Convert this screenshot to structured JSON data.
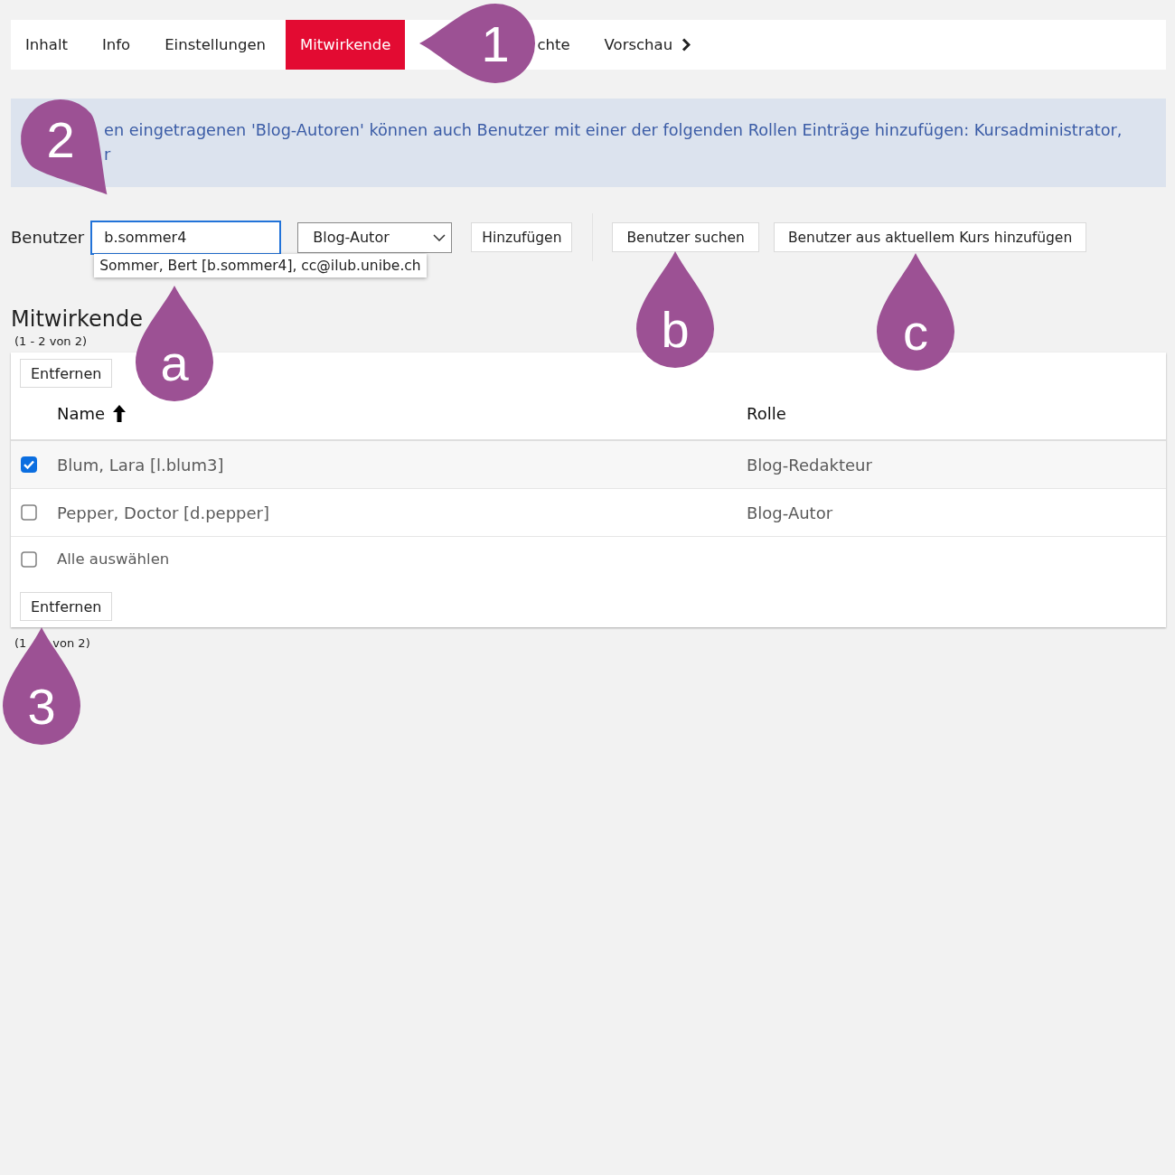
{
  "tabs": [
    {
      "label": "Inhalt",
      "selected": false,
      "expandable": false
    },
    {
      "label": "Info",
      "selected": false,
      "expandable": false
    },
    {
      "label": "Einstellungen",
      "selected": false,
      "expandable": false
    },
    {
      "label": "Mitwirkende",
      "selected": true,
      "expandable": false
    },
    {
      "label": "chte",
      "selected": false,
      "expandable": false
    },
    {
      "label": "Vorschau",
      "selected": false,
      "expandable": true
    }
  ],
  "info": {
    "lines": [
      "en eingetragenen 'Blog-Autoren' können auch Benutzer mit einer der folgenden Rollen Einträge hinzufügen: Kursadministrator,",
      "r"
    ]
  },
  "user_form": {
    "label": "Benutzer",
    "input": {
      "value": "b.sommer4",
      "focused": true
    },
    "suggestion": "Sommer, Bert [b.sommer4], cc@ilub.unibe.ch",
    "role_select": {
      "value": "Blog-Autor"
    },
    "add_button": "Hinzufügen",
    "search_button": "Benutzer suchen",
    "course_button": "Benutzer aus aktuellem Kurs hinzufügen"
  },
  "contributors": {
    "title": "Mitwirkende",
    "range_top": "(1 - 2 von 2)",
    "remove_button_top": "Entfernen",
    "columns": [
      {
        "label": "Name",
        "sorted_ascending": true
      },
      {
        "label": "Rolle",
        "sorted_ascending": false
      }
    ],
    "rows": [
      {
        "name": "Blum, Lara [l.blum3]",
        "role": "Blog-Redakteur",
        "checked": true
      },
      {
        "name": "Pepper, Doctor [d.pepper]",
        "role": "Blog-Autor",
        "checked": false
      }
    ],
    "select_all": {
      "label": "Alle auswählen",
      "checked": false
    },
    "remove_button_bottom": "Entfernen",
    "range_bottom": [
      "(1",
      "von 2)"
    ]
  },
  "annotations": [
    {
      "label": "1"
    },
    {
      "label": "2"
    },
    {
      "label": "a"
    },
    {
      "label": "b"
    },
    {
      "label": "c"
    },
    {
      "label": "3"
    }
  ]
}
